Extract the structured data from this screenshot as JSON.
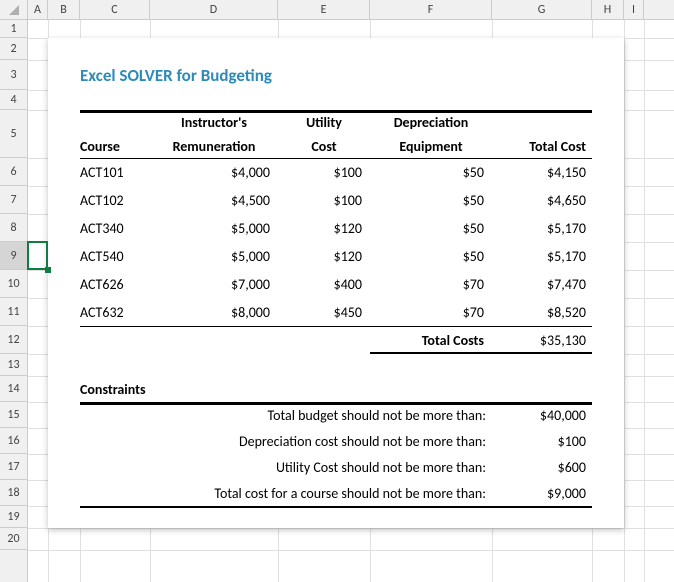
{
  "columns": [
    {
      "letter": "A",
      "w": 20
    },
    {
      "letter": "B",
      "w": 32
    },
    {
      "letter": "C",
      "w": 70
    },
    {
      "letter": "D",
      "w": 128
    },
    {
      "letter": "E",
      "w": 92
    },
    {
      "letter": "F",
      "w": 122
    },
    {
      "letter": "G",
      "w": 100
    },
    {
      "letter": "H",
      "w": 32
    },
    {
      "letter": "I",
      "w": 20
    }
  ],
  "rows": [
    {
      "n": "1",
      "h": 18
    },
    {
      "n": "2",
      "h": 22
    },
    {
      "n": "3",
      "h": 30
    },
    {
      "n": "4",
      "h": 20
    },
    {
      "n": "5",
      "h": 48
    },
    {
      "n": "6",
      "h": 28
    },
    {
      "n": "7",
      "h": 28
    },
    {
      "n": "8",
      "h": 28
    },
    {
      "n": "9",
      "h": 28
    },
    {
      "n": "10",
      "h": 28
    },
    {
      "n": "11",
      "h": 28
    },
    {
      "n": "12",
      "h": 28
    },
    {
      "n": "13",
      "h": 22
    },
    {
      "n": "14",
      "h": 26
    },
    {
      "n": "15",
      "h": 26
    },
    {
      "n": "16",
      "h": 26
    },
    {
      "n": "17",
      "h": 26
    },
    {
      "n": "18",
      "h": 26
    },
    {
      "n": "19",
      "h": 22
    },
    {
      "n": "20",
      "h": 22
    }
  ],
  "selected_row_index": 8,
  "title": "Excel SOLVER for Budgeting",
  "header": {
    "course": "Course",
    "remu1": "Instructor's",
    "remu2": "Remuneration",
    "util1": "Utility",
    "util2": "Cost",
    "dep1": "Depreciation",
    "dep2": "Equipment",
    "total": "Total Cost"
  },
  "courses": [
    {
      "name": "ACT101",
      "remu": "$4,000",
      "util": "$100",
      "dep": "$50",
      "total": "$4,150"
    },
    {
      "name": "ACT102",
      "remu": "$4,500",
      "util": "$100",
      "dep": "$50",
      "total": "$4,650"
    },
    {
      "name": "ACT340",
      "remu": "$5,000",
      "util": "$120",
      "dep": "$50",
      "total": "$5,170"
    },
    {
      "name": "ACT540",
      "remu": "$5,000",
      "util": "$120",
      "dep": "$50",
      "total": "$5,170"
    },
    {
      "name": "ACT626",
      "remu": "$7,000",
      "util": "$400",
      "dep": "$70",
      "total": "$7,470"
    },
    {
      "name": "ACT632",
      "remu": "$8,000",
      "util": "$450",
      "dep": "$70",
      "total": "$8,520"
    }
  ],
  "total_label": "Total Costs",
  "total_value": "$35,130",
  "constraints_title": "Constraints",
  "constraints": [
    {
      "label": "Total budget should not be more than:",
      "value": "$40,000"
    },
    {
      "label": "Depreciation cost should not be more than:",
      "value": "$100"
    },
    {
      "label": "Utility Cost should not be more than:",
      "value": "$600"
    },
    {
      "label": "Total cost for a course should not be more than:",
      "value": "$9,000"
    }
  ],
  "chart_data": {
    "type": "table",
    "title": "Excel SOLVER for Budgeting",
    "columns": [
      "Course",
      "Instructor's Remuneration",
      "Utility Cost",
      "Depreciation Equipment",
      "Total Cost"
    ],
    "rows": [
      [
        "ACT101",
        4000,
        100,
        50,
        4150
      ],
      [
        "ACT102",
        4500,
        100,
        50,
        4650
      ],
      [
        "ACT340",
        5000,
        120,
        50,
        5170
      ],
      [
        "ACT540",
        5000,
        120,
        50,
        5170
      ],
      [
        "ACT626",
        7000,
        400,
        70,
        7470
      ],
      [
        "ACT632",
        8000,
        450,
        70,
        8520
      ]
    ],
    "total": 35130,
    "constraints": {
      "total_budget_max": 40000,
      "depreciation_max": 100,
      "utility_max": 600,
      "course_total_max": 9000
    }
  }
}
